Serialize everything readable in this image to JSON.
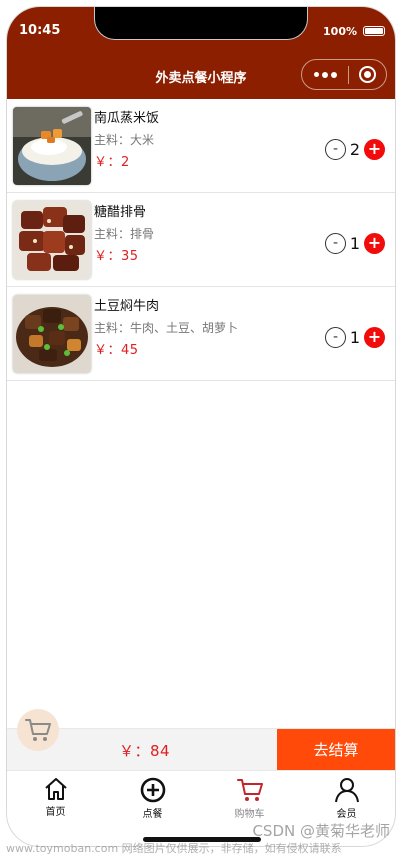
{
  "status_bar": {
    "time": "10:45",
    "battery": "100%"
  },
  "nav": {
    "title": "外卖点餐小程序"
  },
  "items": [
    {
      "name": "南瓜蒸米饭",
      "ingredients": "主料：大米",
      "price": "￥：2",
      "quantity": "2",
      "minus": "-",
      "plus": "+"
    },
    {
      "name": "糖醋排骨",
      "ingredients": "主料：排骨",
      "price": "￥：35",
      "quantity": "1",
      "minus": "-",
      "plus": "+"
    },
    {
      "name": "土豆焖牛肉",
      "ingredients": "主料：牛肉、土豆、胡萝卜",
      "price": "￥：45",
      "quantity": "1",
      "minus": "-",
      "plus": "+"
    }
  ],
  "checkout": {
    "total": "￥：84",
    "button_label": "去结算"
  },
  "tabbar": [
    {
      "label": "首页",
      "icon": "home-icon"
    },
    {
      "label": "点餐",
      "icon": "plus-circle-icon"
    },
    {
      "label": "购物车",
      "icon": "cart-icon"
    },
    {
      "label": "会员",
      "icon": "person-icon"
    }
  ],
  "watermark": "CSDN @黄菊华老师",
  "footer_note": "www.toymoban.com 网络图片仅供展示，非存储，如有侵权请联系",
  "colors": {
    "header": "#8c1f00",
    "price": "#e02020",
    "checkout_button": "#ff4a0a",
    "plus_button": "#f10b0b",
    "cart_tab": "#c2262a"
  }
}
